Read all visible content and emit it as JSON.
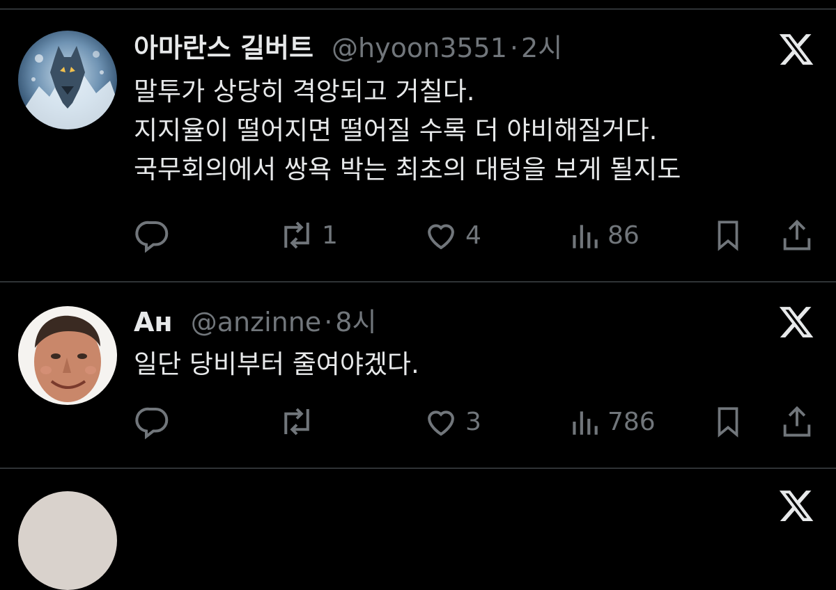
{
  "tweets": [
    {
      "name": "아마란스 길버트",
      "handle": "@hyoon3551",
      "dot": "·",
      "time": "2시",
      "avatar": "wolf-avatar",
      "lines": [
        "말투가 상당히 격앙되고 거칠다.",
        "지지율이 떨어지면 떨어질 수록 더 야비해질거다.",
        "국무회의에서 쌍욕 박는 최초의 대텅을 보게 될지도"
      ],
      "retweets": "1",
      "likes": "4",
      "views": "86"
    },
    {
      "name": "Ан",
      "handle": "@anzinne",
      "dot": "·",
      "time": "8시",
      "avatar": "man-face-avatar",
      "lines": [
        "일단 당비부터 줄여야겠다."
      ],
      "retweets": "",
      "likes": "3",
      "views": "786"
    }
  ],
  "icons": {
    "reply": "reply-icon",
    "retweet": "retweet-icon",
    "like": "heart-icon",
    "views": "views-icon",
    "bookmark": "bookmark-icon",
    "share": "share-icon",
    "brand": "x-logo-icon"
  },
  "colors": {
    "background": "#000000",
    "text": "#e7e9ea",
    "muted": "#71767b",
    "divider": "#2f3336"
  }
}
